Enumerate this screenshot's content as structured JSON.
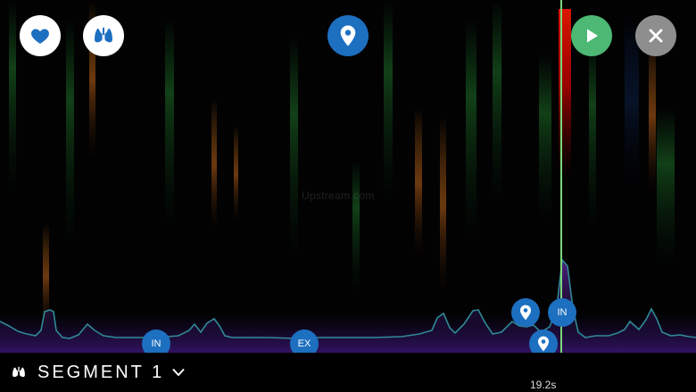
{
  "toolbar": {
    "heart_button": "heart-icon",
    "lungs_button": "lungs-icon",
    "pin_button": "map-pin-icon",
    "play_button": "play-icon",
    "close_button": "close-icon"
  },
  "watermark": "Upstream.com",
  "markers": {
    "in_1": "IN",
    "ex_1": "EX",
    "in_2": "IN"
  },
  "segment": {
    "label": "SEGMENT 1"
  },
  "playback": {
    "time": "19.2s"
  },
  "colors": {
    "accent_blue": "#1d6fc0",
    "play_green": "#4cb874",
    "close_gray": "#8e8e8e",
    "playhead": "#7dd67a",
    "waveform": "#2f8a95"
  }
}
